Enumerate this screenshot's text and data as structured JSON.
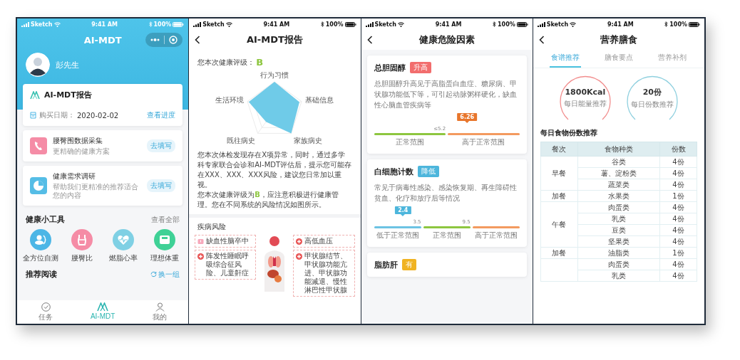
{
  "home": {
    "status_bar": {
      "carrier": "Sketch",
      "time": "9:41 AM",
      "battery": "100%"
    },
    "title": "AI-MDT",
    "user_name": "彭先生",
    "report_card": {
      "title": "AI-MDT报告",
      "date_label": "购买日期：",
      "date": "2020-02-02",
      "link": "查看进度"
    },
    "tasks": [
      {
        "title": "腰臀围数据采集",
        "subtitle": "更精确的健康方案",
        "button": "去填写",
        "kind": "phone",
        "color": "#f58ca6"
      },
      {
        "title": "健康需求调研",
        "subtitle": "帮助我们更精准的推荐适合您的内容",
        "button": "去填写",
        "kind": "pie",
        "color": "#55bde6"
      }
    ],
    "tools_section": {
      "title": "健康小工具",
      "link": "查看全部"
    },
    "tools": [
      {
        "label": "全方位自测",
        "kind": "self-test",
        "color": "#4cb6e6"
      },
      {
        "label": "腰臀比",
        "kind": "waist",
        "color": "#f58ca6"
      },
      {
        "label": "燃脂心率",
        "kind": "heart",
        "color": "#7fd0e4"
      },
      {
        "label": "理想体重",
        "kind": "scale",
        "color": "#3fd196"
      }
    ],
    "reading_section": {
      "title": "推荐阅读",
      "link": "换一组"
    },
    "tab_bar": [
      {
        "label": "任务",
        "kind": "check",
        "selected": false
      },
      {
        "label": "AI-MDT",
        "kind": "logo",
        "selected": true
      },
      {
        "label": "我的",
        "kind": "person",
        "selected": false
      }
    ]
  },
  "report": {
    "status_bar": {
      "carrier": "Sketch",
      "time": "9:41 AM",
      "battery": "100%"
    },
    "title": "AI-MDT报告",
    "grade_label": "您本次健康评级：",
    "grade": "B",
    "radar_labels": [
      "行为习惯",
      "生活环境",
      "基础信息",
      "既往病史",
      "家族病史"
    ],
    "summary": "您本次体检发现存在X项异常，同时，通过多学科专家联合会诊和AI-MDT评估后，提示您可能存在XXX、XXX、XXX风险，建议您日常加以重视。",
    "grade_sentence": {
      "before": "您本次健康评级为",
      "grade": "B",
      "after": "，应注意积极进行健康管理。您在不同系统的风险情况如图所示。"
    },
    "disease_section": {
      "title": "疾病风险",
      "left": [
        {
          "text": "缺血性脑卒中",
          "kind": "brain"
        },
        {
          "text": "阵发性睡眠呼吸综合征风险、儿童鼾症",
          "kind": "cross"
        }
      ],
      "right": [
        {
          "text": "高低血压",
          "kind": "cross"
        },
        {
          "text": "甲状腺结节、甲状腺功能亢进、甲状腺功能减退、慢性淋巴性甲状腺",
          "kind": "cross"
        }
      ]
    }
  },
  "risk_factors": {
    "status_bar": {
      "carrier": "Sketch",
      "time": "9:41 AM",
      "battery": "100%"
    },
    "title": "健康危险因素",
    "factors": [
      {
        "name": "总胆固醇",
        "tag": {
          "text": "升高",
          "color": "#f26d6d"
        },
        "description": "总胆固醇升高见于高脂蛋白血症、糖尿病、甲状腺功能低下等，可引起动脉粥样硬化，缺血性心脑血管疾病等",
        "marker": {
          "value": "6.26",
          "level": 0.64,
          "color": "#e8762c"
        },
        "segments": [
          {
            "label": "正常范围",
            "color": "#8dc63f",
            "end_tick": "≤5.2"
          },
          {
            "label": "高于正常范围",
            "color": "#f39a5f"
          }
        ]
      },
      {
        "name": "白细胞计数",
        "tag": {
          "text": "降低",
          "color": "#4db6dc"
        },
        "description": "常见于病毒性感染、感染恢复期、再生障碍性贫血、化疗和放疗后等情况",
        "marker": {
          "value": "2.4",
          "level": 0.2,
          "color": "#4db6dc"
        },
        "segments": [
          {
            "label": "低于正常范围",
            "color": "#6cc3e3",
            "end_tick": "3.5"
          },
          {
            "label": "正常范围",
            "color": "#8dc63f",
            "end_tick": "9.5"
          },
          {
            "label": "高于正常范围",
            "color": "#f39a5f"
          }
        ]
      },
      {
        "name": "脂肪肝",
        "tag": {
          "text": "有",
          "color": "#f0b323"
        }
      }
    ]
  },
  "nutrition": {
    "status_bar": {
      "carrier": "Sketch",
      "time": "9:41 AM",
      "battery": "100%"
    },
    "title": "营养膳食",
    "tabs": [
      {
        "label": "食谱推荐",
        "selected": true
      },
      {
        "label": "膳食要点",
        "selected": false
      },
      {
        "label": "营养补剂",
        "selected": false
      }
    ],
    "gauges": [
      {
        "value": "1800Kcal",
        "caption": "每日能量推荐",
        "color": "#f28e8e"
      },
      {
        "value": "20份",
        "caption": "每日份数推荐",
        "color": "#8fd0df"
      }
    ],
    "table_title": "每日食物份数推荐",
    "columns": [
      "餐次",
      "食物种类",
      "份数"
    ],
    "groups": [
      {
        "meal": "早餐",
        "items": [
          {
            "food": "谷类",
            "servings": "4份"
          },
          {
            "food": "薯、淀粉类",
            "servings": "4份"
          },
          {
            "food": "蔬菜类",
            "servings": "4份"
          }
        ]
      },
      {
        "meal": "加餐",
        "items": [
          {
            "food": "水果类",
            "servings": "1份"
          }
        ]
      },
      {
        "meal": "午餐",
        "items": [
          {
            "food": "肉蛋类",
            "servings": "4份"
          },
          {
            "food": "乳类",
            "servings": "4份"
          },
          {
            "food": "豆类",
            "servings": "4份"
          },
          {
            "food": "坚果类",
            "servings": "4份"
          }
        ]
      },
      {
        "meal": "加餐",
        "items": [
          {
            "food": "油脂类",
            "servings": "1份"
          }
        ]
      },
      {
        "items": [
          {
            "food": "肉蛋类",
            "servings": "4份"
          },
          {
            "food": "乳类",
            "servings": "4份"
          }
        ]
      }
    ]
  }
}
